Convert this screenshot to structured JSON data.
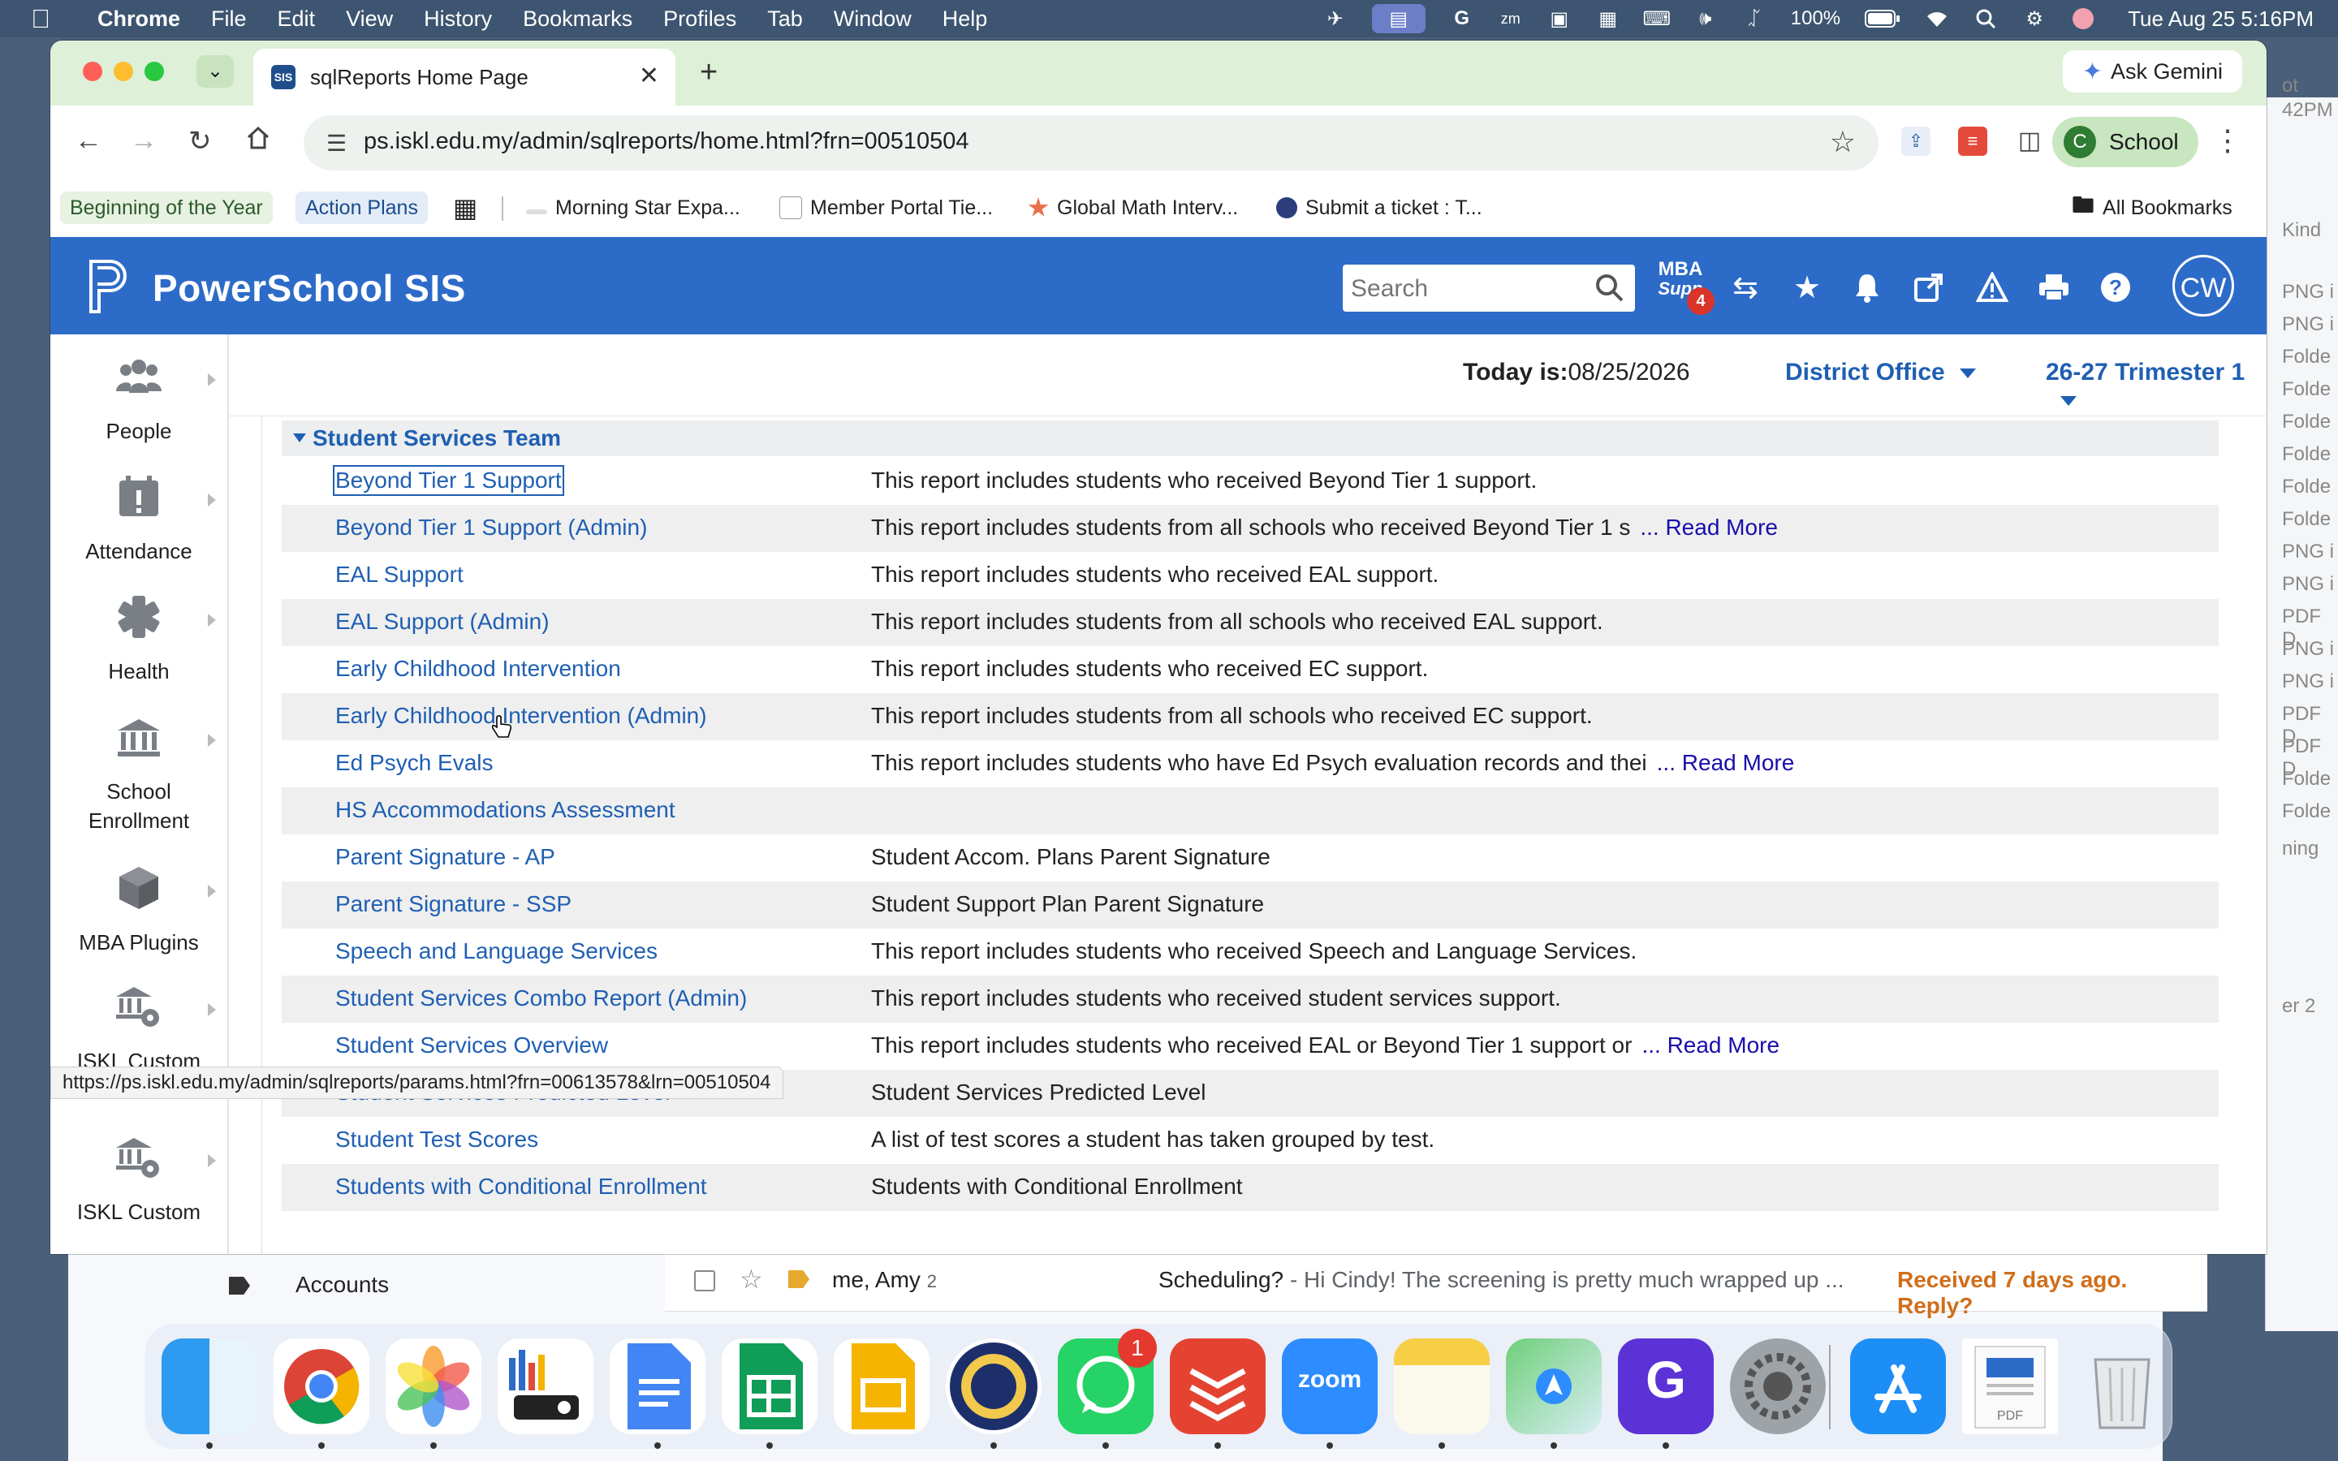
{
  "menubar": {
    "app": "Chrome",
    "items": [
      "File",
      "Edit",
      "View",
      "History",
      "Bookmarks",
      "Profiles",
      "Tab",
      "Window",
      "Help"
    ],
    "battery": "100%",
    "datetime": "Tue Aug 25  5:16PM"
  },
  "background_right": {
    "lines": [
      "ot",
      "42PM",
      "Kind",
      "PNG i",
      "PNG i",
      "Folde",
      "Folde",
      "Folde",
      "Folde",
      "Folde",
      "Folde",
      "PNG i",
      "PNG i",
      "PDF D",
      "PNG i",
      "PNG i",
      "PDF D",
      "PDF D",
      "Folde",
      "Folde",
      "ning",
      "er 2"
    ]
  },
  "gmail_bg": {
    "nav_label": "Accounts",
    "row_from": "me, Amy",
    "row_count": "2",
    "row_subject": "Scheduling?",
    "row_preview": " - Hi Cindy! The screening is pretty much wrapped up ...",
    "row_status": "Received 7 days ago. Reply?"
  },
  "browser": {
    "tab_title": "sqlReports Home Page",
    "tab_favicon": "SIS",
    "ask_gemini": "Ask Gemini",
    "url": "ps.iskl.edu.my/admin/sqlreports/home.html?frn=00510504",
    "profile_initial": "C",
    "profile_name": "School",
    "bookmarks": [
      "Beginning of the Year",
      "Action Plans",
      "Morning Star Expa...",
      "Member Portal Tie...",
      "Global Math Interv...",
      "Submit a ticket : T..."
    ],
    "all_bookmarks": "All Bookmarks",
    "status_url": "https://ps.iskl.edu.my/admin/sqlreports/params.html?frn=00613578&lrn=00510504"
  },
  "ps": {
    "title": "PowerSchool SIS",
    "search_placeholder": "Search",
    "mba_label_1": "MBA",
    "mba_label_2": "Supp",
    "mba_badge": "4",
    "user_initials": "CW",
    "today_label": "Today is:",
    "today_value": "08/25/2026",
    "district": "District Office",
    "term": "26-27 Trimester 1",
    "sidebar": [
      {
        "label": "People"
      },
      {
        "label": "Attendance"
      },
      {
        "label": "Health"
      },
      {
        "label": "School Enrollment"
      },
      {
        "label": "MBA Plugins"
      },
      {
        "label": "ISKL Custom Screens"
      },
      {
        "label": "ISKL Custom"
      }
    ],
    "group_title": "Student Services Team",
    "read_more": "... Read More",
    "reports": [
      {
        "name": "Beyond Tier 1 Support",
        "desc": "This report includes students who received Beyond Tier 1 support."
      },
      {
        "name": "Beyond Tier 1 Support (Admin)",
        "desc": "This report includes students from all schools who received Beyond Tier 1 s"
      },
      {
        "name": "EAL Support",
        "desc": "This report includes students who received EAL support."
      },
      {
        "name": "EAL Support (Admin)",
        "desc": "This report includes students from all schools who received EAL support."
      },
      {
        "name": "Early Childhood Intervention",
        "desc": "This report includes students who received EC support."
      },
      {
        "name": "Early Childhood Intervention (Admin)",
        "desc": "This report includes students from all schools who received EC support."
      },
      {
        "name": "Ed Psych Evals",
        "desc": "This report includes students who have Ed Psych evaluation records and thei"
      },
      {
        "name": "HS Accommodations Assessment",
        "desc": ""
      },
      {
        "name": "Parent Signature - AP",
        "desc": "Student Accom. Plans Parent Signature"
      },
      {
        "name": "Parent Signature - SSP",
        "desc": "Student Support Plan Parent Signature"
      },
      {
        "name": "Speech and Language Services",
        "desc": "This report includes students who received Speech and Language Services."
      },
      {
        "name": "Student Services Combo Report (Admin)",
        "desc": "This report includes students who received student services support."
      },
      {
        "name": "Student Services Overview",
        "desc": "This report includes students who received EAL or Beyond Tier 1 support or"
      },
      {
        "name": "Student Services Predicted Level",
        "desc": "Student Services Predicted Level"
      },
      {
        "name": "Student Test Scores",
        "desc": "A list of test scores a student has taken grouped by test."
      },
      {
        "name": "Students with Conditional Enrollment",
        "desc": "Students with Conditional Enrollment"
      }
    ],
    "read_more_rows": [
      1,
      6,
      12
    ]
  },
  "dock": {
    "zoom_label": "zoom",
    "whatsapp_badge": "1",
    "apps": [
      "finder-icon",
      "chrome-icon",
      "photos-icon",
      "keynote-icon",
      "docs-icon",
      "sheets-icon",
      "slides-icon",
      "iskl-icon",
      "whatsapp-icon",
      "todoist-icon",
      "zoom-icon",
      "notes-icon",
      "maps-icon",
      "gchat-icon",
      "settings-icon",
      "appstore-icon",
      "pdf-doc-icon",
      "trash-icon"
    ]
  },
  "colors": {
    "ps_blue": "#2d6bc8",
    "link_blue": "#1f5fb3",
    "chrome_green": "#dff0d9"
  }
}
